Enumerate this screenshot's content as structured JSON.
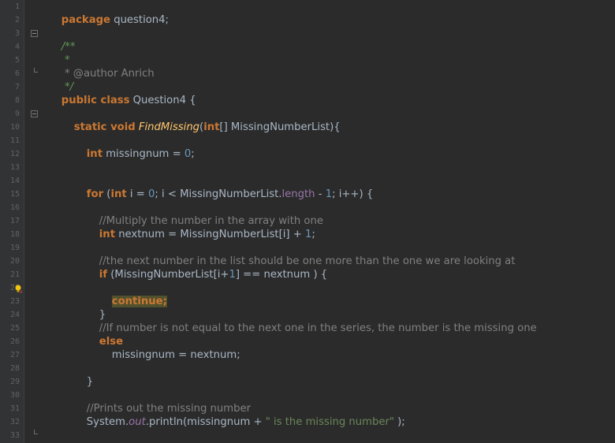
{
  "gutter": {
    "line_numbers": [
      "1",
      "2",
      "3",
      "4",
      "5",
      "6",
      "7",
      "8",
      "9",
      "10",
      "11",
      "12",
      "13",
      "14",
      "15",
      "16",
      "17",
      "18",
      "19",
      "20",
      "21",
      "22",
      "23",
      "24",
      "25",
      "26",
      "27",
      "28",
      "29",
      "30",
      "31",
      "32",
      "33"
    ]
  },
  "code": {
    "l1": {
      "t1": "package",
      "t2": " question4;"
    },
    "l3": {
      "t1": "/**"
    },
    "l4": {
      "t1": " *"
    },
    "l5": {
      "t1": " * @author Anrich"
    },
    "l6": {
      "t1": " */"
    },
    "l7": {
      "t1": "public class",
      "t2": " Question4 {"
    },
    "l9": {
      "t1": "static void",
      "t2": "FindMissing",
      "t3": "(",
      "t4": "int",
      "t5": "[] MissingNumberList){"
    },
    "l11": {
      "t1": "int",
      "t2": " missingnum = ",
      "t3": "0",
      "t4": ";"
    },
    "l14": {
      "t1": "for",
      "t2": " (",
      "t3": "int",
      "t4": " i = ",
      "t5": "0",
      "t6": "; i < MissingNumberList.",
      "t7": "length",
      "t8": " - ",
      "t9": "1",
      "t10": "; i++) {"
    },
    "l16": {
      "t1": "//Multiply the number in the array with one"
    },
    "l17": {
      "t1": "int",
      "t2": " nextnum = MissingNumberList[i] + ",
      "t3": "1",
      "t4": ";"
    },
    "l19": {
      "t1": "//the next number in the list should be one more than the one we are looking at"
    },
    "l20": {
      "t1": "if",
      "t2": " (MissingNumberList[i+",
      "t3": "1",
      "t4": "] == nextnum ) {"
    },
    "l22": {
      "t1": "continue;"
    },
    "l23": {
      "t1": "}"
    },
    "l24": {
      "t1": "//If number is not equal to the next one in the series, the number is the missing one"
    },
    "l25": {
      "t1": "else"
    },
    "l26": {
      "t1": "missingnum = nextnum;"
    },
    "l28": {
      "t1": "}"
    },
    "l30": {
      "t1": "//Prints out the missing number"
    },
    "l31": {
      "t1": "System.",
      "t2": "out",
      "t3": ".println(missingnum + ",
      "t4": "\" is the missing number\"",
      "t5": " );"
    },
    "l33": {
      "t1": "}"
    }
  },
  "colors": {
    "background": "#2b2b2b",
    "keyword": "#cc7832",
    "function": "#ffc66d",
    "number": "#6897bb",
    "string": "#6a8759",
    "comment": "#808080",
    "doc_comment": "#629755",
    "field": "#9876aa"
  },
  "icons": {
    "intention_bulb": "lightbulb-icon",
    "fold": "fold-minus-icon"
  }
}
